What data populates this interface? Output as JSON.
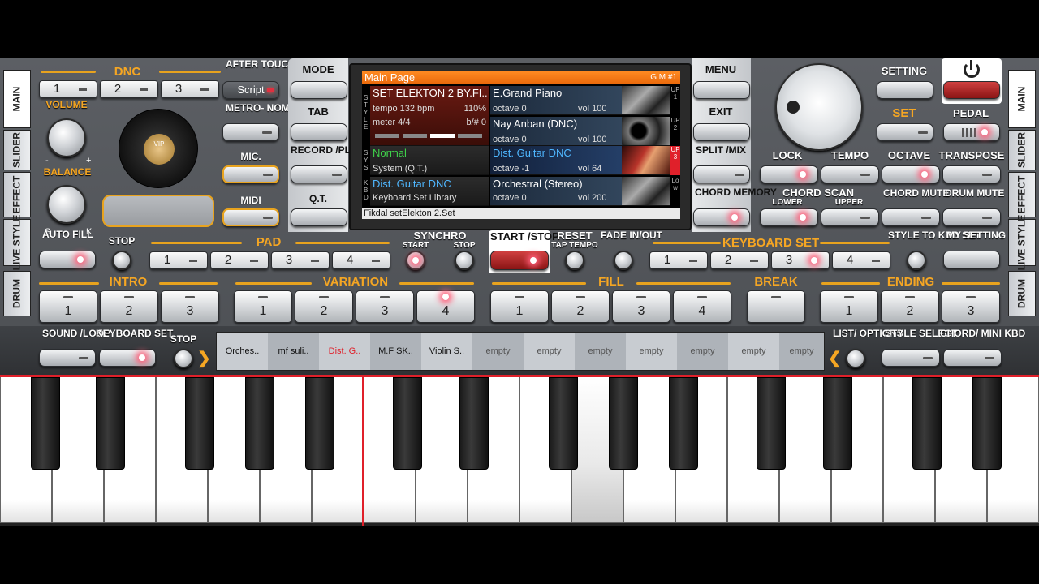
{
  "tabs_left": [
    "MAIN",
    "SLIDER",
    "EFFECT",
    "LIVE STYLE",
    "DRUM"
  ],
  "tabs_right": [
    "MAIN",
    "SLIDER",
    "EFFECT",
    "LIVE STYLE",
    "DRUM"
  ],
  "dnc": {
    "label": "DNC",
    "buttons": [
      "1",
      "2",
      "3"
    ]
  },
  "after_touch": {
    "label": "AFTER TOUCH",
    "value": "Script"
  },
  "volume": "VOLUME",
  "balance": "BALANCE",
  "knob_marks": {
    "minus": "-",
    "plus": "+",
    "s": "S",
    "k": "K"
  },
  "logo": "VIP",
  "metronome": "METRO- NOME",
  "mic": "MIC.",
  "midi": "MIDI",
  "mid_left": {
    "mode": "MODE",
    "tab": "TAB",
    "record": "RECORD /PLAY",
    "qt": "Q.T."
  },
  "mid_right": {
    "menu": "MENU",
    "exit": "EXIT",
    "split": "SPLIT /MIX",
    "chord_memory": "CHORD MEMORY"
  },
  "lcd": {
    "header": "Main Page",
    "header_right": "G M #1",
    "side_labels": {
      "style": "STYLE",
      "sys": "SYS",
      "kbd": "KBD",
      "up1": "UP1",
      "up2": "UP2",
      "up3": "UP3",
      "low": "Low"
    },
    "style_name": "SET ELEKTON 2 BY.FI..",
    "tempo": "tempo 132 bpm",
    "tempo_pct": "110%",
    "meter": "meter 4/4",
    "bsharp": "b/# 0",
    "sys_name": "Normal",
    "sys_sub": "System (Q.T.)",
    "kbd_name": "Dist. Guitar DNC",
    "kbd_sub": "Keyboard Set Library",
    "voices": [
      {
        "name": "E.Grand Piano",
        "octave": "octave 0",
        "vol": "vol 100"
      },
      {
        "name": "Nay Anban (DNC)",
        "octave": "octave 0",
        "vol": "vol 100"
      },
      {
        "name": "Dist. Guitar DNC",
        "octave": "octave -1",
        "vol": "vol 64"
      },
      {
        "name": "Orchestral (Stereo)",
        "octave": "octave 0",
        "vol": "vol 200"
      }
    ],
    "footer": "Fikdal setElekton 2.Set"
  },
  "top_right": {
    "setting": "SETTING",
    "set": "SET",
    "pedal": "PEDAL",
    "lock": "LOCK",
    "tempo": "TEMPO",
    "octave": "OCTAVE",
    "transpose": "TRANSPOSE",
    "chord_scan": "CHORD SCAN",
    "lower": "LOWER",
    "upper": "UPPER",
    "chord_mute": "CHORD MUTE",
    "drum_mute": "DRUM MUTE"
  },
  "row_pad": {
    "auto_fill": "AUTO FILL",
    "stop": "STOP",
    "pad": "PAD",
    "pads": [
      "1",
      "2",
      "3",
      "4"
    ],
    "synchro": "SYNCHRO",
    "sync_start": "START",
    "sync_stop": "STOP",
    "start_stop": "START /STOP",
    "reset": "RESET",
    "tap_tempo": "TAP TEMPO",
    "fade": "FADE IN/OUT",
    "keyboard_set": "KEYBOARD SET",
    "kbd_sets": [
      "1",
      "2",
      "3",
      "4"
    ],
    "style_to": "STYLE TO KBD SET",
    "my_setting": "MY SETTING"
  },
  "sections": {
    "intro": "INTRO",
    "intro_b": [
      "1",
      "2",
      "3"
    ],
    "variation": "VARIATION",
    "variation_b": [
      "1",
      "2",
      "3",
      "4"
    ],
    "fill": "FILL",
    "fill_b": [
      "1",
      "2",
      "3",
      "4"
    ],
    "break": "BREAK",
    "ending": "ENDING",
    "ending_b": [
      "1",
      "2",
      "3"
    ]
  },
  "loops": {
    "sound_loop": "SOUND /LOOP",
    "keyboard_set": "KEYBOARD SET",
    "stop": "STOP",
    "list_options": "LIST/ OPTIONS",
    "style_select": "STYLE SELECT",
    "chord_mini": "CHORD/ MINI KBD",
    "slots": [
      "Orches..",
      "mf suli..",
      "Dist. G..",
      "M.F SK..",
      "Violin S..",
      "empty",
      "empty",
      "empty",
      "empty",
      "empty",
      "empty",
      "empty"
    ]
  },
  "colors": {
    "accent": "#e8a31e",
    "red_line": "#e0202a"
  }
}
